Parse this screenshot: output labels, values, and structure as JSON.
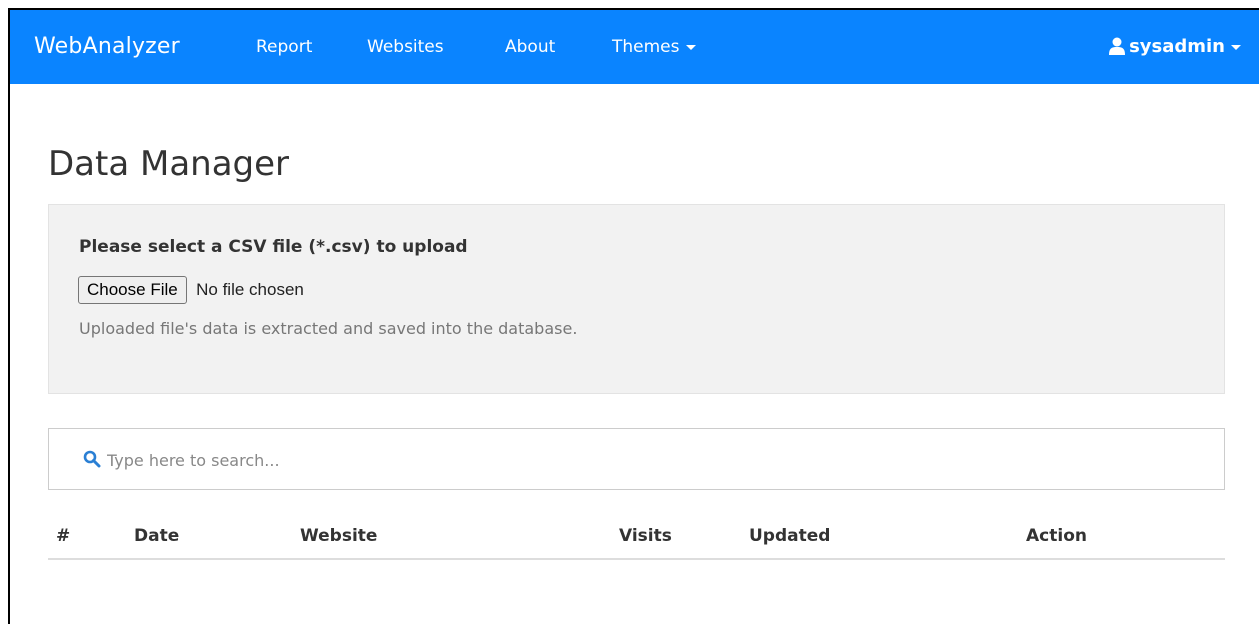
{
  "navbar": {
    "brand": "WebAnalyzer",
    "items": [
      {
        "label": "Report"
      },
      {
        "label": "Websites"
      },
      {
        "label": "About"
      },
      {
        "label": "Themes"
      }
    ],
    "user": "sysadmin",
    "color": "#0a84ff"
  },
  "page": {
    "title": "Data Manager"
  },
  "upload": {
    "label": "Please select a CSV file (*.csv) to upload",
    "button": "Choose File",
    "status": "No file chosen",
    "help": "Uploaded file's data is extracted and saved into the database."
  },
  "search": {
    "placeholder": "Type here to search..."
  },
  "table": {
    "columns": [
      "#",
      "Date",
      "Website",
      "Visits",
      "Updated",
      "Action"
    ],
    "rows": []
  }
}
